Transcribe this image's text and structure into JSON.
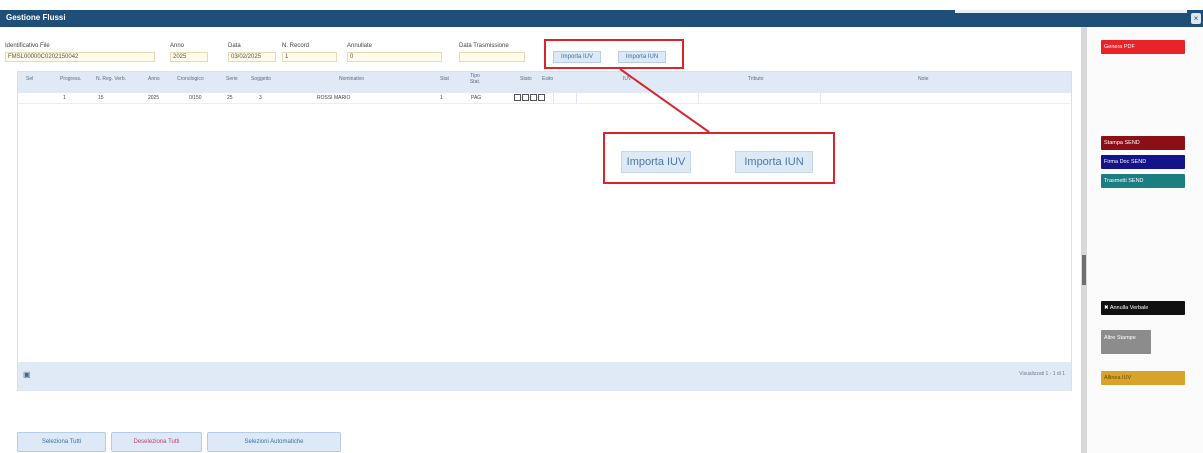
{
  "window": {
    "title": "Gestione Flussi",
    "close_glyph": "×"
  },
  "form": {
    "id_file_label": "Identificativo File",
    "id_file_value": "FMSL00000C0202150042",
    "anno_label": "Anno",
    "anno_value": "2025",
    "data_label": "Data",
    "data_value": "03/02/2025",
    "nrecord_label": "N. Record",
    "nrecord_value": "1",
    "annullate_label": "Annullate",
    "annullate_value": "0",
    "data_trasm_label": "Data Trasmissione",
    "data_trasm_value": ""
  },
  "import_buttons": {
    "iuv_label": "Importa IUV",
    "iun_label": "Importa IUN"
  },
  "grid": {
    "columns": [
      "Sel",
      "Progress.",
      "N. Reg. Verb.",
      "Anno",
      "Cronologico",
      "Serie",
      "Soggetto",
      "Nominativo",
      "Stat",
      "Tipo Stat.",
      "Stato",
      "Esito",
      "IUV",
      "Tributo",
      "Note"
    ],
    "rows": [
      {
        "sel": "",
        "progressivo": "1",
        "n_reg_verb": "15",
        "anno": "2025",
        "cronologico": "0/150",
        "serie": "25",
        "soggetto": "3",
        "nominativo": "ROSSI MARIO",
        "stat": "1",
        "tipo_stat": "PAG",
        "esito": "",
        "iuv": "",
        "tributo": "",
        "note": ""
      }
    ],
    "pager_icon": "page-icon",
    "pager_text": "Visualizzati 1 - 1 di 1"
  },
  "bottom_buttons": {
    "select_all": "Seleziona Tutti",
    "deselect_all": "Deseleziona Tutti",
    "select_auto": "Selezioni Automatiche"
  },
  "zoom_callout": {
    "iuv_label": "Importa IUV",
    "iun_label": "Importa IUN"
  },
  "right_panel": {
    "buttons": [
      {
        "label": "Genera PDF",
        "color": "#e8232a"
      },
      {
        "label": "Stampa SEND",
        "color": "#8b0f16"
      },
      {
        "label": "Firma Doc SEND",
        "color": "#13138a"
      },
      {
        "label": "Trasmetti SEND",
        "color": "#1b7f82"
      },
      {
        "label": "✖ Annulla Verbale",
        "color": "#111111"
      },
      {
        "label": "Altre Stampe",
        "color": "#8c8c8c"
      },
      {
        "label": "Allinea IUV",
        "color": "#d6a32b"
      }
    ]
  },
  "colors": {
    "topbar": "#1f4e79",
    "annotation": "#d9232d",
    "grid_header": "#dfeaf6"
  }
}
